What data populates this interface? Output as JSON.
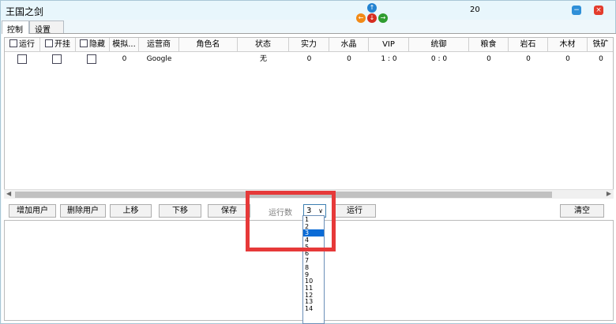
{
  "window": {
    "title": "王国之剑",
    "counter": "20"
  },
  "tabs": [
    {
      "label": "控制"
    },
    {
      "label": "设置"
    }
  ],
  "grid": {
    "headers": [
      "运行",
      "开挂",
      "隐藏",
      "模拟...",
      "运营商",
      "角色名",
      "状态",
      "实力",
      "水晶",
      "VIP",
      "统御",
      "粮食",
      "岩石",
      "木材",
      "铁矿"
    ],
    "row": {
      "sim": "0",
      "operator": "Google",
      "role": "",
      "status": "无",
      "power": "0",
      "crystal": "0",
      "vip": "1 : 0",
      "command": "0 : 0",
      "food": "0",
      "rock": "0",
      "wood": "0",
      "iron": "0"
    }
  },
  "buttons": {
    "add_user": "增加用户",
    "delete_user": "删除用户",
    "move_up": "上移",
    "move_down": "下移",
    "save": "保存",
    "run": "运行",
    "clear": "清空"
  },
  "run_count": {
    "label": "运行数",
    "value": "3"
  },
  "dropdown": {
    "options": [
      "1",
      "2",
      "3",
      "4",
      "5",
      "6",
      "7",
      "8",
      "9",
      "10",
      "11",
      "12",
      "13",
      "14"
    ],
    "selected": "3"
  },
  "colors": {
    "highlight": "#e63939",
    "selected_option": "#0a6bd6"
  }
}
